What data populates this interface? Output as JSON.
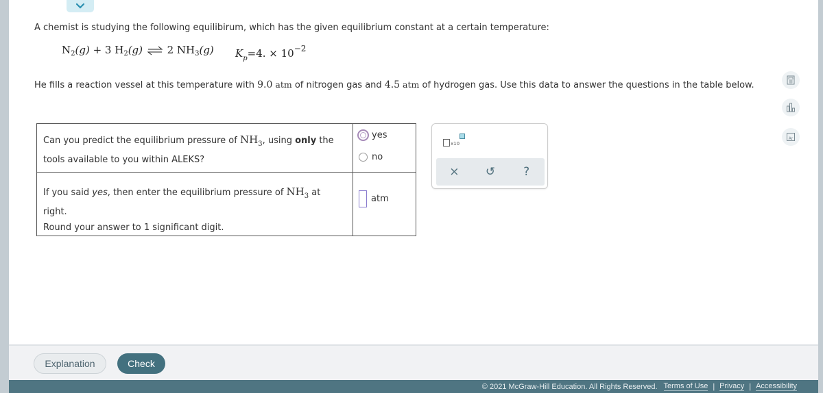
{
  "collapse_tab": {
    "icon": "chevron-down-icon"
  },
  "problem": {
    "intro": "A chemist is studying the following equilibirum, which has the given equilibrium constant at a certain temperature:",
    "equation": {
      "r1": "N",
      "r1_sub": "2",
      "r1_phase": "(g)",
      "plus": " + 3 H",
      "r2_sub": "2",
      "r2_phase": "(g)",
      "product": "2 NH",
      "p_sub": "3",
      "p_phase": "(g)"
    },
    "kp": {
      "symbol": "K",
      "sub": "p",
      "value": "=4. × 10",
      "exponent": "−2"
    },
    "given_parts": {
      "a": "He fills a reaction vessel at this temperature with ",
      "n2_value": "9.0",
      "unit1": " atm",
      "b": " of nitrogen gas and ",
      "h2_value": "4.5",
      "unit2": " atm",
      "c": " of hydrogen gas. Use this data to answer the questions in the table below."
    }
  },
  "table": {
    "q1": {
      "a": "Can you predict the equilibrium pressure of ",
      "chem": "NH",
      "chem_sub": "3",
      "b": ", using ",
      "bold": "only",
      "c": " the tools available to you within ALEKS?",
      "options": [
        {
          "label": "yes",
          "selected": true
        },
        {
          "label": "no",
          "selected": false
        }
      ]
    },
    "q2": {
      "a": "If you said ",
      "italic": "yes",
      "b": ", then enter the equilibrium pressure of ",
      "chem": "NH",
      "chem_sub": "3",
      "c": " at right.",
      "d": "Round your answer to 1 significant digit.",
      "input_value": "",
      "unit": "atm"
    }
  },
  "tool_panel": {
    "sci_notation": "x10",
    "clear": "×",
    "undo": "↺",
    "help": "?"
  },
  "side_tools": [
    "calculator-icon",
    "chart-icon",
    "periodic-table-icon"
  ],
  "buttons": {
    "explanation": "Explanation",
    "check": "Check"
  },
  "footer": {
    "copyright": "© 2021 McGraw-Hill Education. All Rights Reserved.",
    "links": [
      "Terms of Use",
      "Privacy",
      "Accessibility"
    ],
    "separator": "|"
  },
  "colors": {
    "footer_bg": "#4f7582",
    "check_bg": "#43717f",
    "radio_selected": "#a78bb8",
    "input_border": "#8a7ccf"
  }
}
